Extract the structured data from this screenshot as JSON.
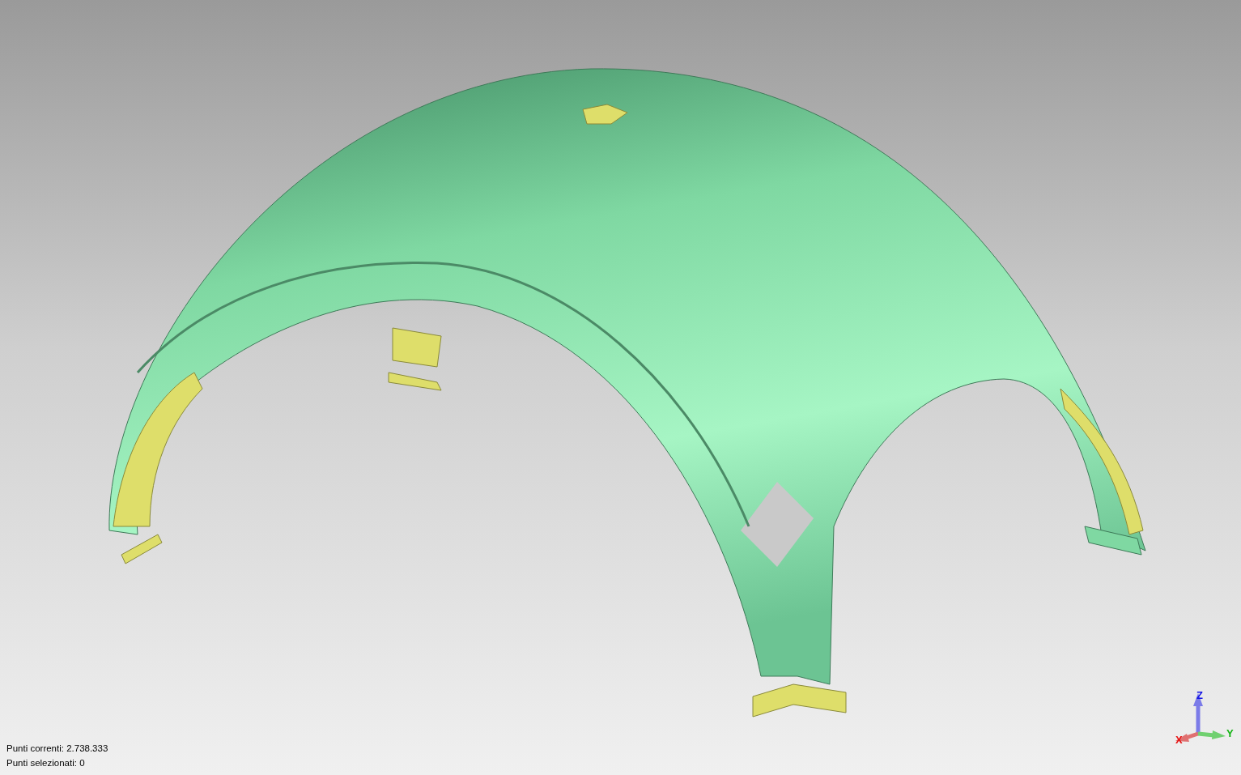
{
  "status_lines": [
    "Punti correnti: 2.738.333",
    "Punti selezionati: 0"
  ],
  "axes": [
    {
      "kind": "z",
      "label": "Z",
      "color": "#1414e6"
    },
    {
      "kind": "x",
      "label": "X",
      "color": "#e61414"
    },
    {
      "kind": "y",
      "label": "Y",
      "color": "#14b414"
    }
  ]
}
